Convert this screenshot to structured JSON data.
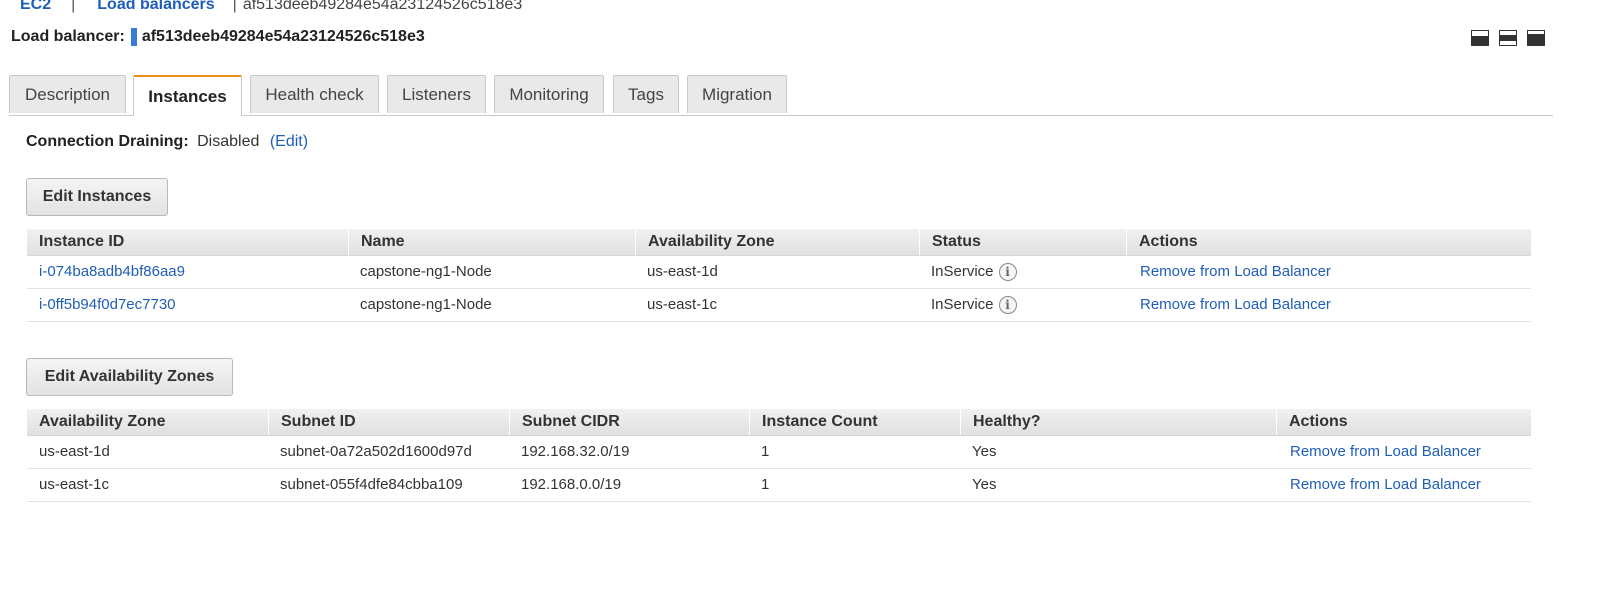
{
  "breadcrumb": {
    "ec2": "EC2",
    "separator": "|",
    "load_balancers": "Load balancers",
    "current": "af513deeb49284e54a23124526c518e3"
  },
  "title": {
    "label": "Load balancer:",
    "name": "af513deeb49284e54a23124526c518e3"
  },
  "tabs": [
    {
      "label": "Description",
      "active": false
    },
    {
      "label": "Instances",
      "active": true
    },
    {
      "label": "Health check",
      "active": false
    },
    {
      "label": "Listeners",
      "active": false
    },
    {
      "label": "Monitoring",
      "active": false
    },
    {
      "label": "Tags",
      "active": false
    },
    {
      "label": "Migration",
      "active": false
    }
  ],
  "connection_draining": {
    "label": "Connection Draining:",
    "value": "Disabled",
    "edit": "(Edit)"
  },
  "instances": {
    "button": "Edit Instances",
    "headers": [
      "Instance ID",
      "Name",
      "Availability Zone",
      "Status",
      "Actions"
    ],
    "rows": [
      {
        "id": "i-074ba8adb4bf86aa9",
        "name": "capstone-ng1-Node",
        "zone": "us-east-1d",
        "status": "InService",
        "action": "Remove from Load Balancer"
      },
      {
        "id": "i-0ff5b94f0d7ec7730",
        "name": "capstone-ng1-Node",
        "zone": "us-east-1c",
        "status": "InService",
        "action": "Remove from Load Balancer"
      }
    ]
  },
  "zones": {
    "button": "Edit Availability Zones",
    "headers": [
      "Availability Zone",
      "Subnet ID",
      "Subnet CIDR",
      "Instance Count",
      "Healthy?",
      "Actions"
    ],
    "rows": [
      {
        "zone": "us-east-1d",
        "subnet": "subnet-0a72a502d1600d97d",
        "cidr": "192.168.32.0/19",
        "count": "1",
        "healthy": "Yes",
        "action": "Remove from Load Balancer"
      },
      {
        "zone": "us-east-1c",
        "subnet": "subnet-055f4dfe84cbba109",
        "cidr": "192.168.0.0/19",
        "count": "1",
        "healthy": "Yes",
        "action": "Remove from Load Balancer"
      }
    ]
  },
  "colors": {
    "link": "#1f5eb8",
    "active_tab_accent": "#ec8c1b",
    "marker": "#3a7bd5"
  }
}
